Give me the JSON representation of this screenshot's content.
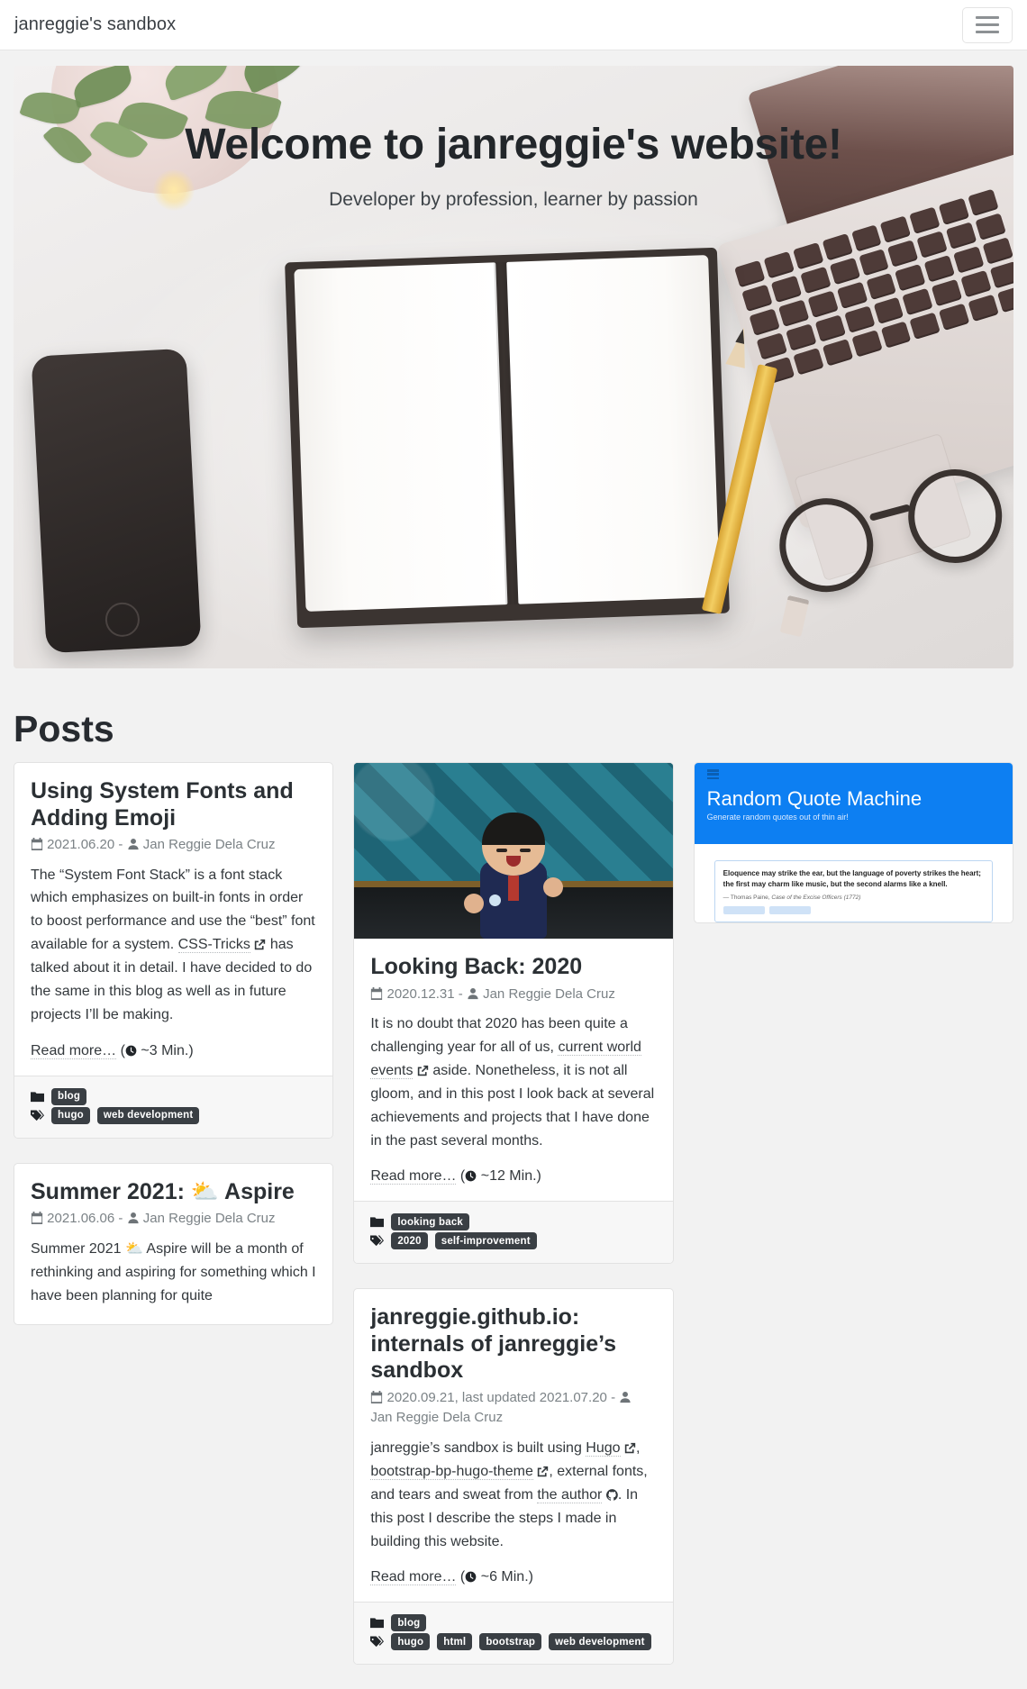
{
  "navbar": {
    "brand": "janreggie's sandbox",
    "toggle_label": "Toggle navigation"
  },
  "hero": {
    "title": "Welcome to janreggie's website!",
    "subtitle": "Developer by profession, learner by passion"
  },
  "section": {
    "posts_heading": "Posts"
  },
  "icons": {
    "calendar": "calendar-icon",
    "user": "user-icon",
    "clock": "clock-icon",
    "folder": "folder-icon",
    "tag": "tag-icon",
    "external": "external-link-icon",
    "github": "github-icon"
  },
  "posts": [
    {
      "id": "using-system-fonts",
      "title": "Using System Fonts and Adding Emoji",
      "date": "2021.06.20",
      "separator": "-",
      "author": "Jan Reggie Dela Cruz",
      "summary_parts": [
        {
          "type": "text",
          "value": "The “System Font Stack” is a font stack which emphasizes on built-in fonts in order to boost performance and use the “best” font available for a system. "
        },
        {
          "type": "link",
          "value": "CSS-Tricks"
        },
        {
          "type": "text",
          "value": " has talked about it in detail. I have decided to do the same in this blog as well as in future projects I’ll be making."
        }
      ],
      "read_more": "Read more…",
      "read_time": "~3 Min.",
      "categories": [
        "blog"
      ],
      "tags": [
        "hugo",
        "web development"
      ]
    },
    {
      "id": "summer-2021-aspire",
      "title": "Summer 2021: ⛅ Aspire",
      "date": "2021.06.06",
      "separator": "-",
      "author": "Jan Reggie Dela Cruz",
      "summary_parts": [
        {
          "type": "text",
          "value": "Summer 2021 ⛅ Aspire will be a month of rethinking and aspiring for something which I have been planning for quite"
        }
      ],
      "read_more": "",
      "read_time": "",
      "categories": [],
      "tags": []
    },
    {
      "id": "looking-back-2020",
      "title": "Looking Back: 2020",
      "date": "2020.12.31",
      "separator": "-",
      "author": "Jan Reggie Dela Cruz",
      "thumbnail": "animal-crossing-character-photo",
      "summary_parts": [
        {
          "type": "text",
          "value": "It is no doubt that 2020 has been quite a challenging year for all of us, "
        },
        {
          "type": "link",
          "value": "current world events"
        },
        {
          "type": "text",
          "value": " aside. Nonetheless, it is not all gloom, and in this post I look back at several achievements and projects that I have done in the past several months."
        }
      ],
      "read_more": "Read more…",
      "read_time": "~12 Min.",
      "categories": [
        "looking back"
      ],
      "tags": [
        "2020",
        "self-improvement"
      ]
    },
    {
      "id": "janreggie-github-io",
      "title": "janreggie.github.io: internals of janreggie’s sandbox",
      "date": "2020.09.21, last updated 2021.07.20",
      "separator": "-",
      "author": "Jan Reggie Dela Cruz",
      "summary_parts": [
        {
          "type": "text",
          "value": "janreggie’s sandbox is built using "
        },
        {
          "type": "link",
          "value": "Hugo"
        },
        {
          "type": "text",
          "value": ", "
        },
        {
          "type": "link",
          "value": "bootstrap-bp-hugo-theme"
        },
        {
          "type": "text",
          "value": ", external fonts, and tears and sweat from "
        },
        {
          "type": "link-github",
          "value": "the author"
        },
        {
          "type": "text",
          "value": ". In this post I describe the steps I made in building this website."
        }
      ],
      "read_more": "Read more…",
      "read_time": "~6 Min.",
      "categories": [
        "blog"
      ],
      "tags": [
        "hugo",
        "html",
        "bootstrap",
        "web development"
      ]
    },
    {
      "id": "random-quote-machine",
      "thumbnail": "random-quote-machine-screenshot",
      "thumbnail_content": {
        "app_title": "Random Quote Machine",
        "app_subtitle": "Generate random quotes out of thin air!",
        "quote": "Eloquence may strike the ear, but the language of poverty strikes the heart; the first may charm like music, but the second alarms like a knell.",
        "attribution_author": "— Thomas Paine, ",
        "attribution_work": "Case of the Excise Officers (1772)",
        "accent_color": "#0d7ff2"
      }
    }
  ],
  "colors": {
    "page_background": "#f2f2f2",
    "card_background": "#ffffff",
    "card_border": "#e2e2e2",
    "badge_background": "#3a3f44",
    "text": "#33383c",
    "muted_text": "#7b8286"
  }
}
